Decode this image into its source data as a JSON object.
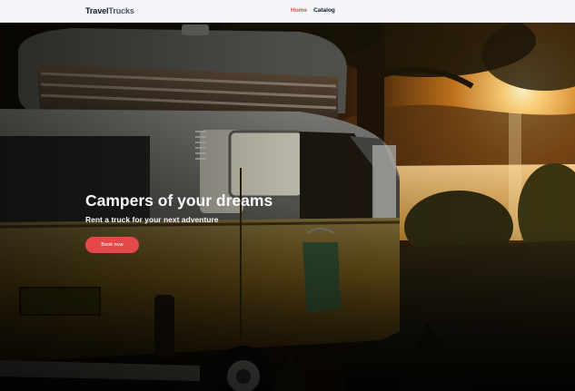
{
  "header": {
    "logo_part1": "Travel",
    "logo_part2": "Trucks",
    "nav": {
      "home": "Home",
      "catalog": "Catalog"
    }
  },
  "hero": {
    "title": "Campers of your dreams",
    "subtitle": "Rent a truck for your next adventure",
    "cta_label": "Book now"
  },
  "colors": {
    "accent": "#e44848",
    "header_bg": "#f4f5f8",
    "text_dark": "#101828"
  }
}
